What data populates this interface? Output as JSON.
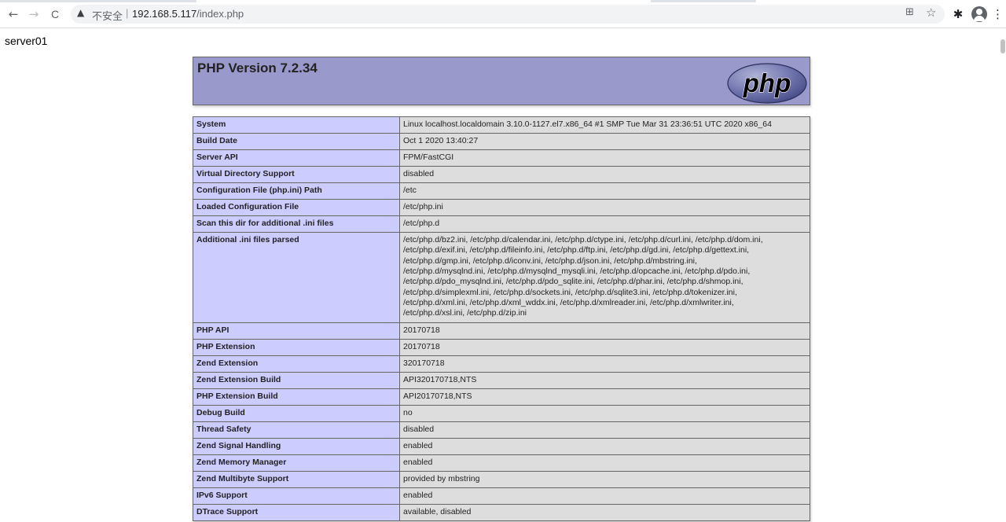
{
  "browser": {
    "security_label": "不安全",
    "separator": "|",
    "url_host": "192.168.5.117",
    "url_path": "/index.php",
    "back_glyph": "←",
    "forward_glyph": "→",
    "reload_glyph": "C",
    "warning_glyph": "▲",
    "translate_glyph": "⊞",
    "star_glyph": "☆",
    "extensions_glyph": "✱",
    "menu_glyph": "⋮"
  },
  "page": {
    "server_name": "server01",
    "php_title": "PHP Version 7.2.34",
    "logo_text": "php"
  },
  "info_rows": [
    {
      "key": "System",
      "value": "Linux localhost.localdomain 3.10.0-1127.el7.x86_64 #1 SMP Tue Mar 31 23:36:51 UTC 2020 x86_64"
    },
    {
      "key": "Build Date",
      "value": "Oct 1 2020 13:40:27"
    },
    {
      "key": "Server API",
      "value": "FPM/FastCGI"
    },
    {
      "key": "Virtual Directory Support",
      "value": "disabled"
    },
    {
      "key": "Configuration File (php.ini) Path",
      "value": "/etc"
    },
    {
      "key": "Loaded Configuration File",
      "value": "/etc/php.ini"
    },
    {
      "key": "Scan this dir for additional .ini files",
      "value": "/etc/php.d"
    },
    {
      "key": "Additional .ini files parsed",
      "lines": [
        "/etc/php.d/bz2.ini, /etc/php.d/calendar.ini, /etc/php.d/ctype.ini, /etc/php.d/curl.ini, /etc/php.d/dom.ini,",
        "/etc/php.d/exif.ini, /etc/php.d/fileinfo.ini, /etc/php.d/ftp.ini, /etc/php.d/gd.ini, /etc/php.d/gettext.ini,",
        "/etc/php.d/gmp.ini, /etc/php.d/iconv.ini, /etc/php.d/json.ini, /etc/php.d/mbstring.ini,",
        "/etc/php.d/mysqlnd.ini, /etc/php.d/mysqlnd_mysqli.ini, /etc/php.d/opcache.ini, /etc/php.d/pdo.ini,",
        "/etc/php.d/pdo_mysqlnd.ini, /etc/php.d/pdo_sqlite.ini, /etc/php.d/phar.ini, /etc/php.d/shmop.ini,",
        "/etc/php.d/simplexml.ini, /etc/php.d/sockets.ini, /etc/php.d/sqlite3.ini, /etc/php.d/tokenizer.ini,",
        "/etc/php.d/xml.ini, /etc/php.d/xml_wddx.ini, /etc/php.d/xmlreader.ini, /etc/php.d/xmlwriter.ini,",
        "/etc/php.d/xsl.ini, /etc/php.d/zip.ini"
      ]
    },
    {
      "key": "PHP API",
      "value": "20170718"
    },
    {
      "key": "PHP Extension",
      "value": "20170718"
    },
    {
      "key": "Zend Extension",
      "value": "320170718"
    },
    {
      "key": "Zend Extension Build",
      "value": "API320170718,NTS"
    },
    {
      "key": "PHP Extension Build",
      "value": "API20170718,NTS"
    },
    {
      "key": "Debug Build",
      "value": "no"
    },
    {
      "key": "Thread Safety",
      "value": "disabled"
    },
    {
      "key": "Zend Signal Handling",
      "value": "enabled"
    },
    {
      "key": "Zend Memory Manager",
      "value": "enabled"
    },
    {
      "key": "Zend Multibyte Support",
      "value": "provided by mbstring"
    },
    {
      "key": "IPv6 Support",
      "value": "enabled"
    },
    {
      "key": "DTrace Support",
      "value": "available, disabled"
    }
  ]
}
